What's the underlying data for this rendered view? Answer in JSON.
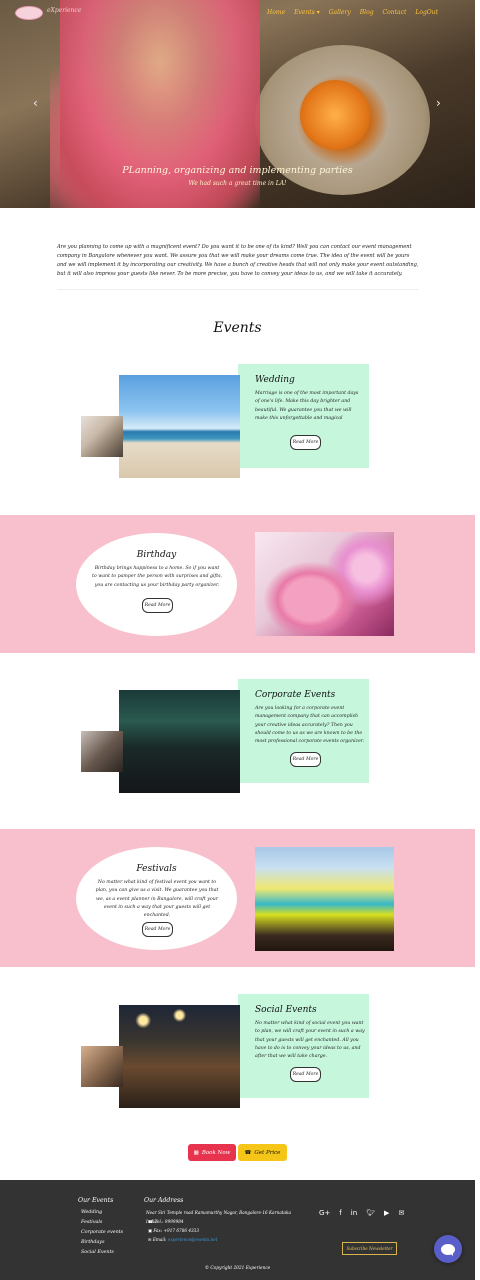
{
  "brand": {
    "name": "eXperience"
  },
  "nav": {
    "items": [
      "Home",
      "Events ▾",
      "Gallery",
      "Blog",
      "Contact",
      "LogOut"
    ]
  },
  "hero": {
    "title": "PLanning, organizing and implementing parties",
    "subtitle": "We had such a great time in LA!",
    "prev_icon": "chevron-left-icon",
    "next_icon": "chevron-right-icon"
  },
  "intro": {
    "text": "Are you planning to come up with a magnificent event? Do you want it to be one of its kind? Well you can contact our event management company in Bangalore whenever you want. We assure you that we will make your dreams come true. The idea of the event will be yours and we will implement it by incorporating our creativity. We have a bunch of creative heads that will not only make your event outstanding, but it will also impress your guests like never. To be more precise, you have to convey your ideas to us, and we will take it accurately."
  },
  "events_section": {
    "title": "Events"
  },
  "events": [
    {
      "title": "Wedding",
      "text": "Marriage is one of the most important days of one's life. Make this day brighter and beautiful. We guarantee you that we will make this unforgettable and magical",
      "button": "Read More"
    },
    {
      "title": "Birthday",
      "text": "Birthday brings happiness to a home. So if you want to want to pamper the person with surprises and gifts, you are contacting us your birthday party organizer.",
      "button": "Read More"
    },
    {
      "title": "Corporate Events",
      "text": "Are you looking for a corporate event management company that can accomplish your creative ideas accurately? Then you should come to us as we are known to be the most professional corporate events organizer.",
      "button": "Read More"
    },
    {
      "title": "Festivals",
      "text": "No matter what kind of festival event you want to plan, you can give us a visit. We guarantee you that we, as a event planner in Bangalore, will craft your event in such a way that your guests will get enchanted.",
      "button": "Read More"
    },
    {
      "title": "Social Events",
      "text": "No matter what kind of social event you want to plan, we will craft your event in such a way that your guests will get enchanted. All you have to do is to convey your ideas to us, and after that we will take charge.",
      "button": "Read More"
    }
  ],
  "actions": {
    "book_now": "Book Now",
    "book_icon": "calendar-icon",
    "get_price": "Get Price",
    "price_icon": "phone-icon"
  },
  "footer": {
    "events_heading": "Our Events",
    "event_links": [
      "Wedding",
      "Festivals",
      "Corporate events",
      "Birthdays",
      "Social Events"
    ],
    "address_heading": "Our Address",
    "address": "Near Siri Temple road Ramamurthy Nagar, Bangalore-16 Karnataka India",
    "tel": "Tel.: 9999984",
    "fax": "Fax: +917 6786 4333",
    "email_label": "Email:",
    "email": "experience@events.net",
    "social_icons": [
      "google-plus-icon",
      "facebook-icon",
      "linkedin-icon",
      "twitter-icon",
      "youtube-icon",
      "mail-icon"
    ],
    "newsletter": "Subscribe Newsletter",
    "copyright": "© Copyright 2021 Experience"
  },
  "colors": {
    "pink_band": "#f8c0cc",
    "mint_card": "#c6f7dd",
    "nav_text": "#ffc43a",
    "footer_bg": "#333333",
    "book_button": "#e8334f",
    "price_button": "#f5c518",
    "chat_button": "#5a5ec8"
  }
}
